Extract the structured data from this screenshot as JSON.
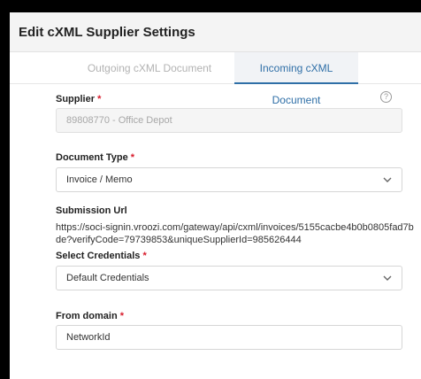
{
  "dialog": {
    "title": "Edit cXML Supplier Settings"
  },
  "tabs": [
    {
      "label": "Outgoing cXML Document",
      "active": false
    },
    {
      "label": "Incoming cXML Document",
      "active": true
    }
  ],
  "form": {
    "supplier": {
      "label": "Supplier",
      "required_mark": "*",
      "value": "89808770 - Office Depot",
      "help_icon": "question-circle"
    },
    "document_type": {
      "label": "Document Type",
      "required_mark": "*",
      "value": "Invoice / Memo"
    },
    "submission_url": {
      "label": "Submission Url",
      "value": "https://soci-signin.vroozi.com/gateway/api/cxml/invoices/5155cacbe4b0b0805fad7bde?verifyCode=79739853&uniqueSupplierId=985626444"
    },
    "credentials": {
      "label": "Select Credentials",
      "required_mark": "*",
      "value": "Default Credentials"
    },
    "from_domain": {
      "label": "From domain",
      "required_mark": "*",
      "value": "NetworkId"
    }
  },
  "colors": {
    "accent": "#2f6fa7",
    "required": "#d81b2b",
    "tab_active_bg": "#f1f3f6",
    "header_bg": "#f4f4f4"
  }
}
